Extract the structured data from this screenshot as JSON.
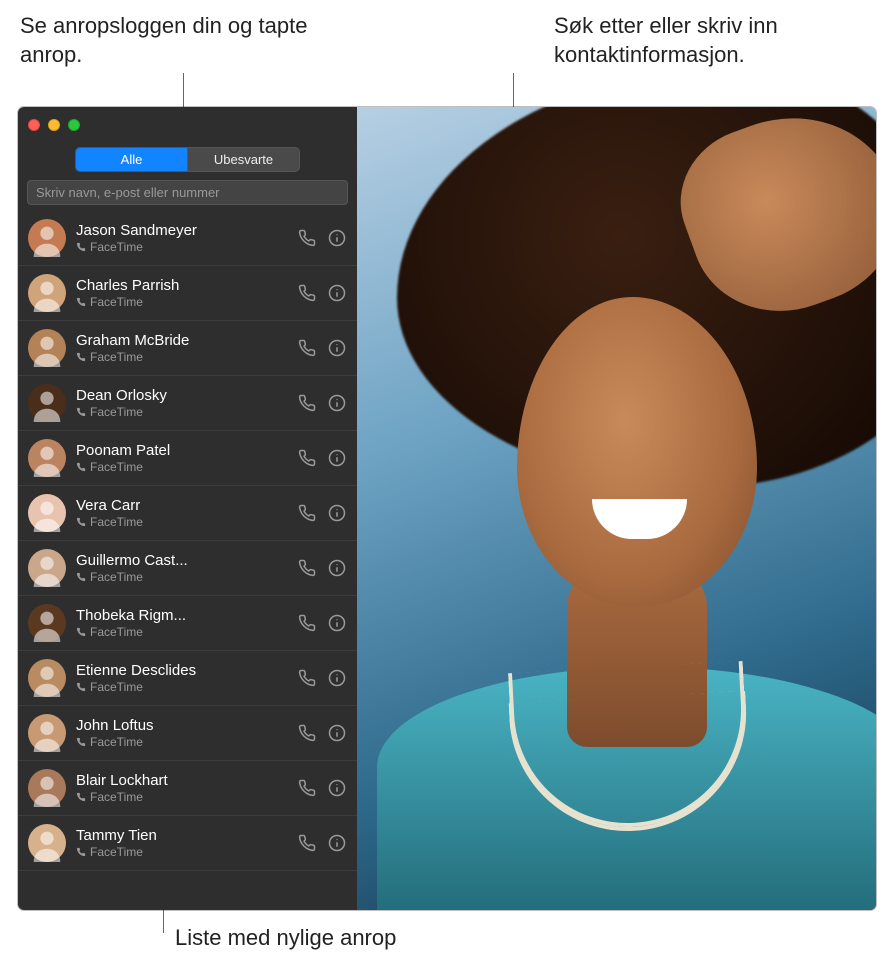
{
  "callouts": {
    "tabs": "Se anropsloggen din og tapte anrop.",
    "search": "Søk etter eller skriv inn kontaktinformasjon.",
    "list": "Liste med nylige anrop"
  },
  "tabs": {
    "all": "Alle",
    "missed": "Ubesvarte"
  },
  "search": {
    "placeholder": "Skriv navn, e-post eller nummer"
  },
  "subLabel": "FaceTime",
  "avatarColors": [
    "#c47b52",
    "#d0a47a",
    "#b38256",
    "#4a2e1a",
    "#bb8460",
    "#e8c4b0",
    "#caa68a",
    "#5b3920",
    "#b88b60",
    "#c79a74",
    "#a9795b",
    "#d7b08c"
  ],
  "contacts": [
    {
      "name": "Jason Sandmeyer"
    },
    {
      "name": "Charles Parrish"
    },
    {
      "name": "Graham McBride"
    },
    {
      "name": "Dean Orlosky"
    },
    {
      "name": "Poonam Patel"
    },
    {
      "name": "Vera Carr"
    },
    {
      "name": "Guillermo Cast..."
    },
    {
      "name": "Thobeka Rigm..."
    },
    {
      "name": "Etienne Desclides"
    },
    {
      "name": "John Loftus"
    },
    {
      "name": "Blair Lockhart"
    },
    {
      "name": "Tammy Tien"
    }
  ]
}
